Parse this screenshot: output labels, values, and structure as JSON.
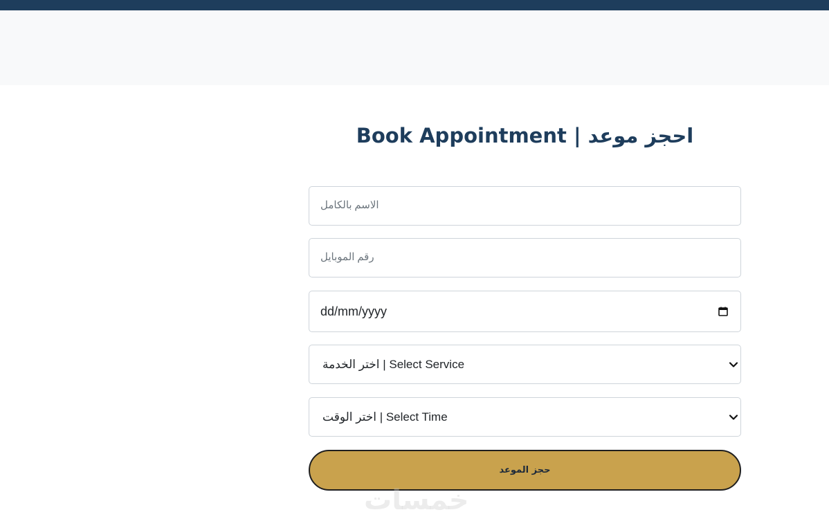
{
  "colors": {
    "topbar": "#1e3d5c",
    "hero": "#f8f9fa",
    "title": "#1e3d5c",
    "submit_bg": "#c9a24d",
    "submit_border": "#1f1f1f"
  },
  "page": {
    "title": "Book Appointment | احجز موعد"
  },
  "form": {
    "name_placeholder": "الاسم بالكامل",
    "mobile_placeholder": "رقم الموبايل",
    "date_value": "dd/mm/yyyy",
    "date_icon": "calendar-icon",
    "service_selected": "اختر الخدمة | Select Service",
    "time_selected": "اختر الوقت | Select Time",
    "select_icon": "chevron-down-icon",
    "submit_label": "حجز الموعد"
  },
  "watermark": {
    "text": "خمسات"
  }
}
